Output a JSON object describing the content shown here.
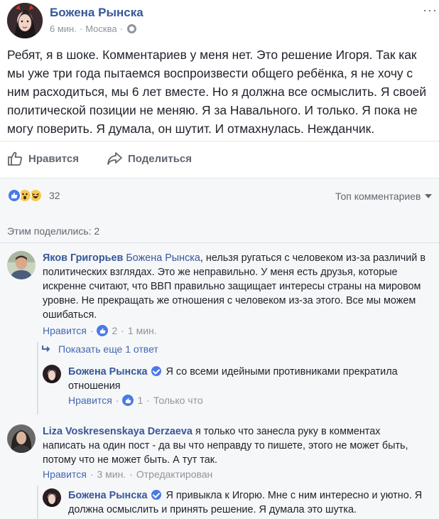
{
  "post": {
    "author": "Божена Рынска",
    "time": "6 мин.",
    "separator": "·",
    "location": "Москва",
    "text": "Ребят, я в шоке. Комментариев у меня нет. Это решение Игоря. Так как мы уже три года пытаемся воспроизвести общего ребёнка, я не хочу с ним расходиться, мы 6 лет вместе. Но я должна все осмыслить. Я своей политической позиции не меняю. Я за Навального. И только. Я пока не могу поверить. Я думала, он шутит. И отмахнулась. Нежданчик.",
    "more_icon": "more-dots-icon",
    "privacy_icon": "globe-icon"
  },
  "actions": {
    "like_label": "Нравится",
    "share_label": "Поделиться"
  },
  "reactions": {
    "count": "32",
    "types": [
      "like",
      "wow",
      "haha"
    ],
    "top_comments_label": "Топ комментариев",
    "shared_label": "Этим поделились: 2"
  },
  "comments": [
    {
      "author": "Яков Григорьев",
      "mention": "Божена Рынска",
      "text": ", нельзя ругаться с человеком из-за различий в политических взглядах. Это же неправильно. У меня есть друзья, которые искренне считают, что ВВП правильно защищает интересы страны на мировом уровне. Не прекращать же отношения с человеком из-за этого. Все мы можем ошибаться.",
      "like_label": "Нравится",
      "likes": "2",
      "time": "1 мин.",
      "show_replies": "Показать еще 1 ответ",
      "reply": {
        "author": "Божена Рынска",
        "text": "Я со всеми идейными противниками прекратила отношения",
        "like_label": "Нравится",
        "likes": "1",
        "time": "Только что"
      }
    },
    {
      "author": "Liza Voskresenskaya Derzaeva",
      "text": "я только что занесла руку в комментах написать на один пост - да вы что неправду то пишете, этого не может быть, потому что не может быть. А тут так.",
      "like_label": "Нравится",
      "time": "3 мин.",
      "edited": "Отредактирован",
      "reply": {
        "author": "Божена Рынска",
        "text": "Я привыкла к Игорю. Мне с ним интересно и уютно. Я должна осмыслить и принять решение. Я думала это шутка."
      }
    }
  ],
  "colors": {
    "link": "#365899",
    "accent": "#4267b2",
    "muted": "#90949c",
    "comments_bg": "#f6f7f9"
  }
}
